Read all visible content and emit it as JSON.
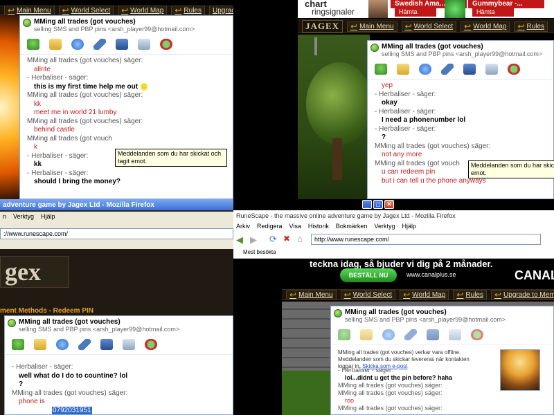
{
  "nav_labels": {
    "main_menu": "Main Menu",
    "world_select": "World Select",
    "world_map": "World Map",
    "rules": "Rules",
    "upgrade_to": "Upgrade to",
    "upgrade_members": "Upgrade to Members"
  },
  "ad_banner": {
    "chart_word": "chart",
    "ringsignaler": "ringsignaler",
    "song1": "Swedish Ama...",
    "song2": "Gummybear -...",
    "hamta": "Hämta"
  },
  "msn_common": {
    "contact_name": "MMing all trades  (got vouches)",
    "contact_sub": "selling SMS and PBP pins <arsh_player99@hotmail.com>"
  },
  "tooltip": {
    "text": "Meddelanden som du har skickat och tagit emot.",
    "text_cut": "Meddelanden som du har skickat och tagit",
    "text_cut2": "emot."
  },
  "quad_tl": {
    "lines": [
      {
        "t": "spk",
        "v": "MMing all trades  (got vouches) säger:"
      },
      {
        "t": "msg",
        "v": "allrite"
      },
      {
        "t": "spk",
        "v": "- Herbaliser - säger:"
      },
      {
        "t": "msgb",
        "v": "this is my first time help me out"
      },
      {
        "t": "spk",
        "v": "MMing all trades  (got vouches) säger:"
      },
      {
        "t": "msg",
        "v": "kk"
      },
      {
        "t": "msg",
        "v": "meet me in world 21 lumby"
      },
      {
        "t": "spk",
        "v": "MMing all trades  (got vouches) säger:"
      },
      {
        "t": "msg",
        "v": "behind castle"
      },
      {
        "t": "spk",
        "v": "MMing all trades  (got vouch"
      },
      {
        "t": "msg",
        "v": "k"
      },
      {
        "t": "spk",
        "v": "- Herbaliser - säger:"
      },
      {
        "t": "msgb",
        "v": "kk"
      },
      {
        "t": "spk",
        "v": "- Herbaliser - säger:"
      },
      {
        "t": "msgb",
        "v": "should I bring the money?"
      }
    ]
  },
  "quad_tr": {
    "lines": [
      {
        "t": "msg",
        "v": "yep"
      },
      {
        "t": "spk",
        "v": "- Herbaliser - säger:"
      },
      {
        "t": "msgb",
        "v": "okay"
      },
      {
        "t": "spk",
        "v": "- Herbaliser - säger:"
      },
      {
        "t": "msgb",
        "v": "I need a phonenumber lol"
      },
      {
        "t": "spk",
        "v": "- Herbaliser - säger:"
      },
      {
        "t": "msgb",
        "v": "?"
      },
      {
        "t": "spk",
        "v": "MMing all trades  (got vouches) säger:"
      },
      {
        "t": "msg",
        "v": "not any more"
      },
      {
        "t": "spk",
        "v": "MMing all trades  (got vouch"
      },
      {
        "t": "msg",
        "v": "u can redeem pin"
      },
      {
        "t": "msg",
        "v": "but i can tell u the phone anyways"
      }
    ]
  },
  "quad_bl": {
    "window_title": "adventure game by Jagex Ltd - Mozilla Firefox",
    "menu": [
      "n",
      "Verktyg",
      "Hjälp"
    ],
    "url": "://www.runescape.com/",
    "logo_text": "gex",
    "heading": "ment Methods - Redeem PIN",
    "lines": [
      {
        "t": "spk",
        "v": "- Herbaliser - säger:"
      },
      {
        "t": "msgb",
        "v": "well what do I do to countine? lol"
      },
      {
        "t": "msgb",
        "v": "?"
      },
      {
        "t": "spk",
        "v": "MMing all trades  (got vouches) säger:"
      },
      {
        "t": "msg",
        "v": "phone is"
      },
      {
        "t": "sel",
        "v": "0792031951"
      }
    ]
  },
  "quad_br": {
    "window_title": "RuneScape - the massive online adventure game by Jagex Ltd - Mozilla Firefox",
    "menu": [
      "Arkiv",
      "Redigera",
      "Visa",
      "Historik",
      "Bokmärken",
      "Verktyg",
      "Hjälp"
    ],
    "url": "http://www.runescape.com/",
    "bookmark": "Mest besökta",
    "ad_text": "teckna idag, så bjuder vi dig på 2 månader.",
    "ad_button": "BESTÄLL NU",
    "ad_url": "www.canalplus.se",
    "canal": "CANAL",
    "nav_main": "Main Menu",
    "nav_world": "World Select",
    "nav_map": "World Map",
    "nav_rules": "Rules",
    "nav_upgrade": "Upgrade to Members",
    "offline_note": "MMing all trades  (got vouches) verkar vara offline. Meddelanden som du skickar levereras när kontakten loggar in.",
    "offline_link": "Skicka som e-post",
    "lines": [
      {
        "t": "spk",
        "v": "- Herbaliser - säger:"
      },
      {
        "t": "msgb",
        "v": "lol...didnt u get the pin before? haha"
      },
      {
        "t": "spk",
        "v": "MMing all trades  (got vouches) säger:"
      },
      {
        "t": "spk",
        "v": "MMing all trades  (got vouches) säger:"
      },
      {
        "t": "msg",
        "v": "roo"
      },
      {
        "t": "spk",
        "v": "MMing all trades  (got vouches) säger:"
      }
    ]
  }
}
